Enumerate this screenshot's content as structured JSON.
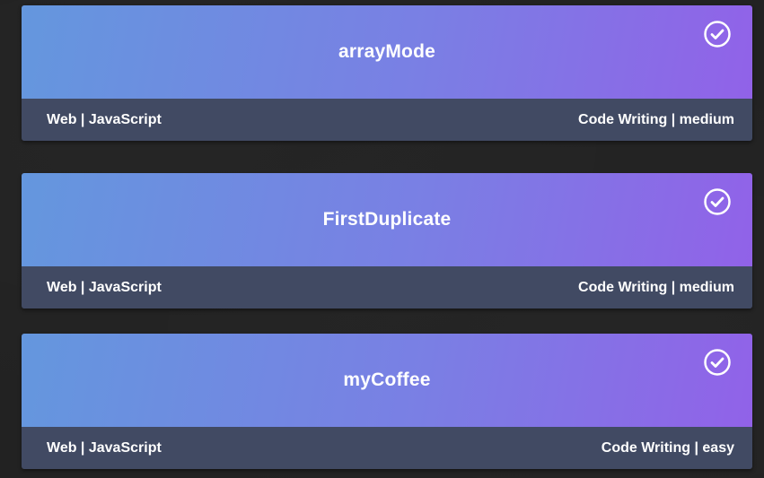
{
  "challenges": [
    {
      "title": "arrayMode",
      "category": "Web | JavaScript",
      "type_difficulty": "Code Writing | medium",
      "completed_icon": "check-circle-icon"
    },
    {
      "title": "FirstDuplicate",
      "category": "Web | JavaScript",
      "type_difficulty": "Code Writing | medium",
      "completed_icon": "check-circle-icon"
    },
    {
      "title": "myCoffee",
      "category": "Web | JavaScript",
      "type_difficulty": "Code Writing | easy",
      "completed_icon": "check-circle-icon"
    }
  ],
  "colors": {
    "background": "#222222",
    "gradient_start": "#6497de",
    "gradient_end": "#9162e8",
    "footer": "#414a63",
    "text": "#ffffff"
  }
}
